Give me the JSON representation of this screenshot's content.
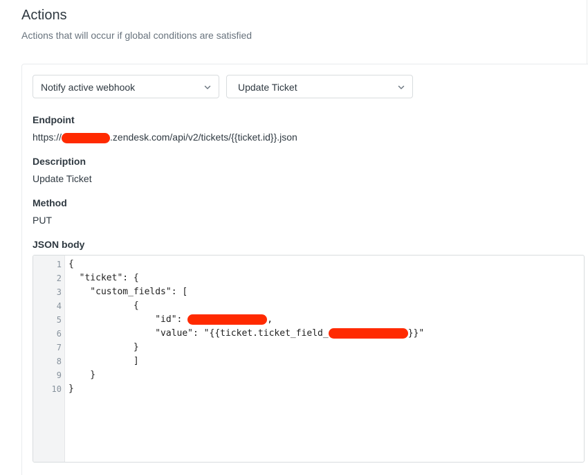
{
  "section": {
    "title": "Actions",
    "subtitle": "Actions that will occur if global conditions are satisfied"
  },
  "action": {
    "type_select": "Notify active webhook",
    "webhook_select": "Update Ticket"
  },
  "endpoint": {
    "label": "Endpoint",
    "prefix": "https://",
    "suffix": ".zendesk.com/api/v2/tickets/{{ticket.id}}.json"
  },
  "description": {
    "label": "Description",
    "value": "Update Ticket"
  },
  "method": {
    "label": "Method",
    "value": "PUT"
  },
  "json_body": {
    "label": "JSON body",
    "line_numbers": [
      "1",
      "2",
      "3",
      "4",
      "5",
      "6",
      "7",
      "8",
      "9",
      "10"
    ],
    "lines": [
      "{",
      "  \"ticket\": {",
      "    \"custom_fields\": [",
      "            {",
      "                \"id\": ",
      "                \"value\": \"{{ticket.ticket_field_",
      "            }",
      "            ]",
      "    }",
      "}"
    ],
    "line5_after_redaction": ",",
    "line6_after_redaction": "}}\""
  },
  "colors": {
    "redaction": "#ff2a00",
    "border": "#d8dcde",
    "muted_text": "#68737d"
  },
  "icons": {
    "select_chevron": "chevron-down-icon"
  }
}
